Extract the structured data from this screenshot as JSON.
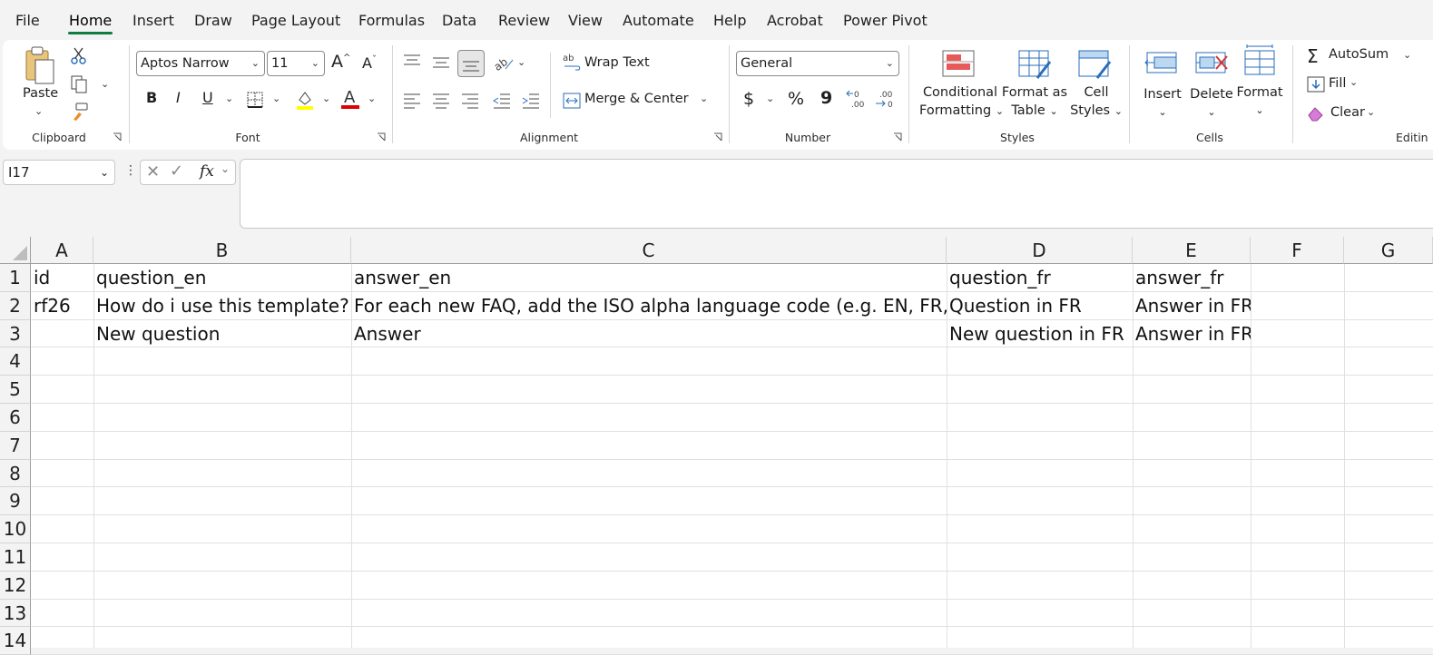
{
  "menu": [
    "File",
    "Home",
    "Insert",
    "Draw",
    "Page Layout",
    "Formulas",
    "Data",
    "Review",
    "View",
    "Automate",
    "Help",
    "Acrobat",
    "Power Pivot"
  ],
  "ribbon": {
    "clipboard": {
      "label": "Clipboard",
      "paste": "Paste"
    },
    "font": {
      "label": "Font",
      "font_name": "Aptos Narrow",
      "font_size": "11",
      "bold": "B",
      "italic": "I",
      "underline": "U",
      "increase": "A",
      "decrease": "A"
    },
    "alignment": {
      "label": "Alignment",
      "wrap_text": "Wrap Text",
      "merge_center": "Merge & Center"
    },
    "number": {
      "label": "Number",
      "format": "General",
      "currency": "$",
      "percent": "%",
      "comma": "9"
    },
    "styles": {
      "label": "Styles",
      "conditional_1": "Conditional",
      "conditional_2": "Formatting",
      "format_table_1": "Format as",
      "format_table_2": "Table",
      "cell_styles_1": "Cell",
      "cell_styles_2": "Styles"
    },
    "cells": {
      "label": "Cells",
      "insert": "Insert",
      "delete": "Delete",
      "format": "Format"
    },
    "editing": {
      "label": "Editin",
      "autosum": "AutoSum",
      "fill": "Fill",
      "clear": "Clear"
    }
  },
  "formula_bar": {
    "name_box": "I17",
    "fx": "fx",
    "content": ""
  },
  "grid": {
    "columns": [
      "A",
      "B",
      "C",
      "D",
      "E",
      "F",
      "G"
    ],
    "rows": [
      "1",
      "2",
      "3",
      "4",
      "5",
      "6",
      "7",
      "8",
      "9",
      "10",
      "11",
      "12",
      "13",
      "14"
    ],
    "cells": [
      [
        "id",
        "question_en",
        "answer_en",
        "question_fr",
        "answer_fr",
        "",
        ""
      ],
      [
        "rf26",
        "How do i use this template?",
        "For each new FAQ, add the ISO alpha language code (e.g. EN, FR, NL)",
        "Question in FR",
        "Answer in FR",
        "",
        ""
      ],
      [
        "",
        "New question",
        "Answer",
        "New question in FR",
        "Answer in FR",
        "",
        ""
      ]
    ]
  },
  "colors": {
    "accent": "#107c41",
    "font_highlight": "#ffff00",
    "font_color": "#e00000"
  }
}
